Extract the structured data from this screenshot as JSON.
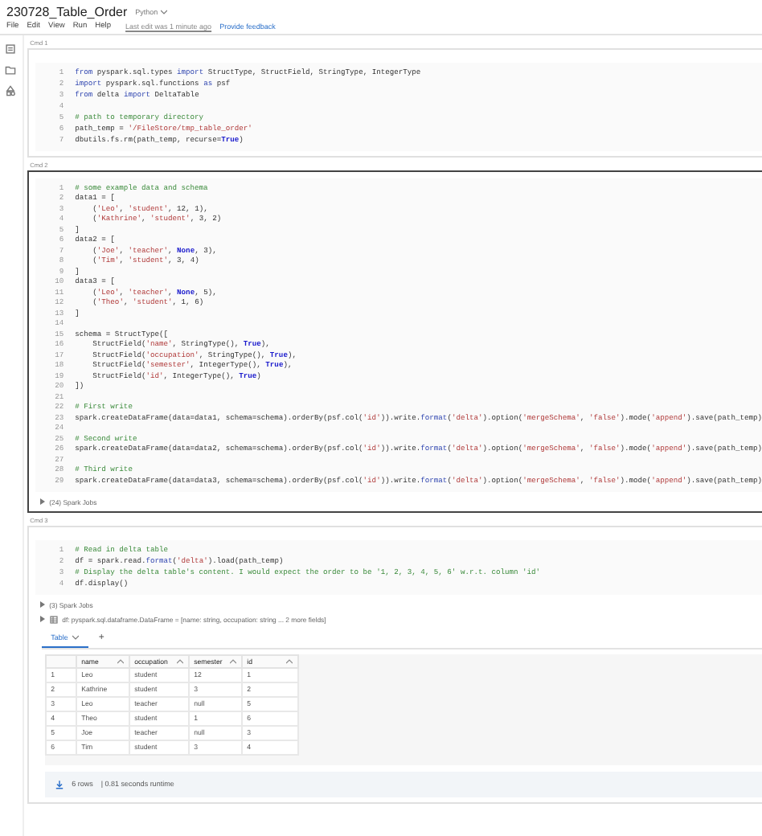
{
  "notebook": {
    "title": "230728_Table_Order",
    "language": "Python",
    "menu": [
      "File",
      "Edit",
      "View",
      "Run",
      "Help"
    ],
    "last_edit": "Last edit was 1 minute ago",
    "feedback": "Provide feedback"
  },
  "cells": [
    {
      "label": "Cmd 1",
      "selected": false,
      "lines": [
        {
          "n": "1",
          "seg": [
            {
              "kind": "keyword",
              "text": "from"
            },
            {
              "kind": "plain",
              "text": " pyspark.sql.types "
            },
            {
              "kind": "keyword",
              "text": "import"
            },
            {
              "kind": "plain",
              "text": " StructType, StructField, StringType, IntegerType"
            }
          ]
        },
        {
          "n": "2",
          "seg": [
            {
              "kind": "keyword",
              "text": "import"
            },
            {
              "kind": "plain",
              "text": " pyspark.sql.functions "
            },
            {
              "kind": "keyword",
              "text": "as"
            },
            {
              "kind": "plain",
              "text": " psf"
            }
          ]
        },
        {
          "n": "3",
          "seg": [
            {
              "kind": "keyword",
              "text": "from"
            },
            {
              "kind": "plain",
              "text": " delta "
            },
            {
              "kind": "keyword",
              "text": "import"
            },
            {
              "kind": "plain",
              "text": " DeltaTable"
            }
          ]
        },
        {
          "n": "4"
        },
        {
          "n": "5",
          "seg": [
            {
              "kind": "comment",
              "text": "# path to temporary directory"
            }
          ]
        },
        {
          "n": "6",
          "seg": [
            {
              "kind": "plain",
              "text": "path_temp = "
            },
            {
              "kind": "string",
              "text": "'/FileStore/tmp_table_order'"
            }
          ]
        },
        {
          "n": "7",
          "seg": [
            {
              "kind": "plain",
              "text": "dbutils.fs.rm(path_temp, recurse="
            },
            {
              "kind": "builtin",
              "text": "True"
            },
            {
              "kind": "plain",
              "text": ")"
            }
          ]
        }
      ]
    },
    {
      "label": "Cmd 2",
      "selected": true,
      "lines": [
        {
          "n": "1",
          "seg": [
            {
              "kind": "comment",
              "text": "# some example data and schema"
            }
          ]
        },
        {
          "n": "2",
          "seg": [
            {
              "kind": "plain",
              "text": "data1 = ["
            }
          ]
        },
        {
          "n": "3",
          "seg": [
            {
              "kind": "plain",
              "text": "    ("
            },
            {
              "kind": "string",
              "text": "'Leo'"
            },
            {
              "kind": "plain",
              "text": ", "
            },
            {
              "kind": "string",
              "text": "'student'"
            },
            {
              "kind": "plain",
              "text": ", 12, 1),"
            }
          ]
        },
        {
          "n": "4",
          "seg": [
            {
              "kind": "plain",
              "text": "    ("
            },
            {
              "kind": "string",
              "text": "'Kathrine'"
            },
            {
              "kind": "plain",
              "text": ", "
            },
            {
              "kind": "string",
              "text": "'student'"
            },
            {
              "kind": "plain",
              "text": ", 3, 2)"
            }
          ]
        },
        {
          "n": "5",
          "seg": [
            {
              "kind": "plain",
              "text": "]"
            }
          ]
        },
        {
          "n": "6",
          "seg": [
            {
              "kind": "plain",
              "text": "data2 = ["
            }
          ]
        },
        {
          "n": "7",
          "seg": [
            {
              "kind": "plain",
              "text": "    ("
            },
            {
              "kind": "string",
              "text": "'Joe'"
            },
            {
              "kind": "plain",
              "text": ", "
            },
            {
              "kind": "string",
              "text": "'teacher'"
            },
            {
              "kind": "plain",
              "text": ", "
            },
            {
              "kind": "builtin",
              "text": "None"
            },
            {
              "kind": "plain",
              "text": ", 3),"
            }
          ]
        },
        {
          "n": "8",
          "seg": [
            {
              "kind": "plain",
              "text": "    ("
            },
            {
              "kind": "string",
              "text": "'Tim'"
            },
            {
              "kind": "plain",
              "text": ", "
            },
            {
              "kind": "string",
              "text": "'student'"
            },
            {
              "kind": "plain",
              "text": ", 3, 4)"
            }
          ]
        },
        {
          "n": "9",
          "seg": [
            {
              "kind": "plain",
              "text": "]"
            }
          ]
        },
        {
          "n": "10",
          "seg": [
            {
              "kind": "plain",
              "text": "data3 = ["
            }
          ]
        },
        {
          "n": "11",
          "seg": [
            {
              "kind": "plain",
              "text": "    ("
            },
            {
              "kind": "string",
              "text": "'Leo'"
            },
            {
              "kind": "plain",
              "text": ", "
            },
            {
              "kind": "string",
              "text": "'teacher'"
            },
            {
              "kind": "plain",
              "text": ", "
            },
            {
              "kind": "builtin",
              "text": "None"
            },
            {
              "kind": "plain",
              "text": ", 5),"
            }
          ]
        },
        {
          "n": "12",
          "seg": [
            {
              "kind": "plain",
              "text": "    ("
            },
            {
              "kind": "string",
              "text": "'Theo'"
            },
            {
              "kind": "plain",
              "text": ", "
            },
            {
              "kind": "string",
              "text": "'student'"
            },
            {
              "kind": "plain",
              "text": ", 1, 6)"
            }
          ]
        },
        {
          "n": "13",
          "seg": [
            {
              "kind": "plain",
              "text": "]"
            }
          ]
        },
        {
          "n": "14"
        },
        {
          "n": "15",
          "seg": [
            {
              "kind": "plain",
              "text": "schema = StructType(["
            }
          ]
        },
        {
          "n": "16",
          "seg": [
            {
              "kind": "plain",
              "text": "    StructField("
            },
            {
              "kind": "string",
              "text": "'name'"
            },
            {
              "kind": "plain",
              "text": ", StringType(), "
            },
            {
              "kind": "builtin",
              "text": "True"
            },
            {
              "kind": "plain",
              "text": "),"
            }
          ]
        },
        {
          "n": "17",
          "seg": [
            {
              "kind": "plain",
              "text": "    StructField("
            },
            {
              "kind": "string",
              "text": "'occupation'"
            },
            {
              "kind": "plain",
              "text": ", StringType(), "
            },
            {
              "kind": "builtin",
              "text": "True"
            },
            {
              "kind": "plain",
              "text": "),"
            }
          ]
        },
        {
          "n": "18",
          "seg": [
            {
              "kind": "plain",
              "text": "    StructField("
            },
            {
              "kind": "string",
              "text": "'semester'"
            },
            {
              "kind": "plain",
              "text": ", IntegerType(), "
            },
            {
              "kind": "builtin",
              "text": "True"
            },
            {
              "kind": "plain",
              "text": "),"
            }
          ]
        },
        {
          "n": "19",
          "seg": [
            {
              "kind": "plain",
              "text": "    StructField("
            },
            {
              "kind": "string",
              "text": "'id'"
            },
            {
              "kind": "plain",
              "text": ", IntegerType(), "
            },
            {
              "kind": "builtin",
              "text": "True"
            },
            {
              "kind": "plain",
              "text": ")"
            }
          ]
        },
        {
          "n": "20",
          "seg": [
            {
              "kind": "plain",
              "text": "])"
            }
          ]
        },
        {
          "n": "21"
        },
        {
          "n": "22",
          "seg": [
            {
              "kind": "comment",
              "text": "# First write"
            }
          ]
        },
        {
          "n": "23",
          "seg": [
            {
              "kind": "plain",
              "text": "spark.createDataFrame(data=data1, schema=schema).orderBy(psf.col("
            },
            {
              "kind": "string",
              "text": "'id'"
            },
            {
              "kind": "plain",
              "text": ")).write."
            },
            {
              "kind": "keyword",
              "text": "format"
            },
            {
              "kind": "plain",
              "text": "("
            },
            {
              "kind": "string",
              "text": "'delta'"
            },
            {
              "kind": "plain",
              "text": ").option("
            },
            {
              "kind": "string",
              "text": "'mergeSchema'"
            },
            {
              "kind": "plain",
              "text": ", "
            },
            {
              "kind": "string",
              "text": "'false'"
            },
            {
              "kind": "plain",
              "text": ").mode("
            },
            {
              "kind": "string",
              "text": "'append'"
            },
            {
              "kind": "plain",
              "text": ").save(path_temp)"
            }
          ]
        },
        {
          "n": "24"
        },
        {
          "n": "25",
          "seg": [
            {
              "kind": "comment",
              "text": "# Second write"
            }
          ]
        },
        {
          "n": "26",
          "seg": [
            {
              "kind": "plain",
              "text": "spark.createDataFrame(data=data2, schema=schema).orderBy(psf.col("
            },
            {
              "kind": "string",
              "text": "'id'"
            },
            {
              "kind": "plain",
              "text": ")).write."
            },
            {
              "kind": "keyword",
              "text": "format"
            },
            {
              "kind": "plain",
              "text": "("
            },
            {
              "kind": "string",
              "text": "'delta'"
            },
            {
              "kind": "plain",
              "text": ").option("
            },
            {
              "kind": "string",
              "text": "'mergeSchema'"
            },
            {
              "kind": "plain",
              "text": ", "
            },
            {
              "kind": "string",
              "text": "'false'"
            },
            {
              "kind": "plain",
              "text": ").mode("
            },
            {
              "kind": "string",
              "text": "'append'"
            },
            {
              "kind": "plain",
              "text": ").save(path_temp)"
            }
          ]
        },
        {
          "n": "27"
        },
        {
          "n": "28",
          "seg": [
            {
              "kind": "comment",
              "text": "# Third write"
            }
          ]
        },
        {
          "n": "29",
          "seg": [
            {
              "kind": "plain",
              "text": "spark.createDataFrame(data=data3, schema=schema).orderBy(psf.col("
            },
            {
              "kind": "string",
              "text": "'id'"
            },
            {
              "kind": "plain",
              "text": ")).write."
            },
            {
              "kind": "keyword",
              "text": "format"
            },
            {
              "kind": "plain",
              "text": "("
            },
            {
              "kind": "string",
              "text": "'delta'"
            },
            {
              "kind": "plain",
              "text": ").option("
            },
            {
              "kind": "string",
              "text": "'mergeSchema'"
            },
            {
              "kind": "plain",
              "text": ", "
            },
            {
              "kind": "string",
              "text": "'false'"
            },
            {
              "kind": "plain",
              "text": ").mode("
            },
            {
              "kind": "string",
              "text": "'append'"
            },
            {
              "kind": "plain",
              "text": ").save(path_temp)"
            }
          ]
        }
      ],
      "outputs": [
        {
          "kind": "jobs",
          "text": "(24) Spark Jobs"
        }
      ]
    },
    {
      "label": "Cmd 3",
      "selected": false,
      "lines": [
        {
          "n": "1",
          "seg": [
            {
              "kind": "comment",
              "text": "# Read in delta table"
            }
          ]
        },
        {
          "n": "2",
          "seg": [
            {
              "kind": "plain",
              "text": "df = spark.read."
            },
            {
              "kind": "keyword",
              "text": "format"
            },
            {
              "kind": "plain",
              "text": "("
            },
            {
              "kind": "string",
              "text": "'delta'"
            },
            {
              "kind": "plain",
              "text": ").load(path_temp)"
            }
          ]
        },
        {
          "n": "3",
          "seg": [
            {
              "kind": "comment",
              "text": "# Display the delta table's content. I would expect the order to be '1, 2, 3, 4, 5, 6' w.r.t. column 'id'"
            }
          ]
        },
        {
          "n": "4",
          "seg": [
            {
              "kind": "plain",
              "text": "df.display()"
            }
          ]
        }
      ],
      "outputs": [
        {
          "kind": "jobs",
          "text": "(3) Spark Jobs"
        },
        {
          "kind": "schema",
          "text": "df: pyspark.sql.dataframe.DataFrame = [name: string, occupation: string ... 2 more fields]"
        }
      ],
      "result": {
        "tabs": [
          {
            "label": "Table",
            "selected": true
          }
        ],
        "add": "+",
        "columns": [
          "",
          "name",
          "occupation",
          "semester",
          "id"
        ],
        "rows": [
          [
            "1",
            "Leo",
            "student",
            "12",
            "1"
          ],
          [
            "2",
            "Kathrine",
            "student",
            "3",
            "2"
          ],
          [
            "3",
            "Leo",
            "teacher",
            "null",
            "5"
          ],
          [
            "4",
            "Theo",
            "student",
            "1",
            "6"
          ],
          [
            "5",
            "Joe",
            "teacher",
            "null",
            "3"
          ],
          [
            "6",
            "Tim",
            "student",
            "3",
            "4"
          ]
        ],
        "row_count": "6 rows",
        "runtime": "| 0.81 seconds runtime"
      }
    }
  ]
}
